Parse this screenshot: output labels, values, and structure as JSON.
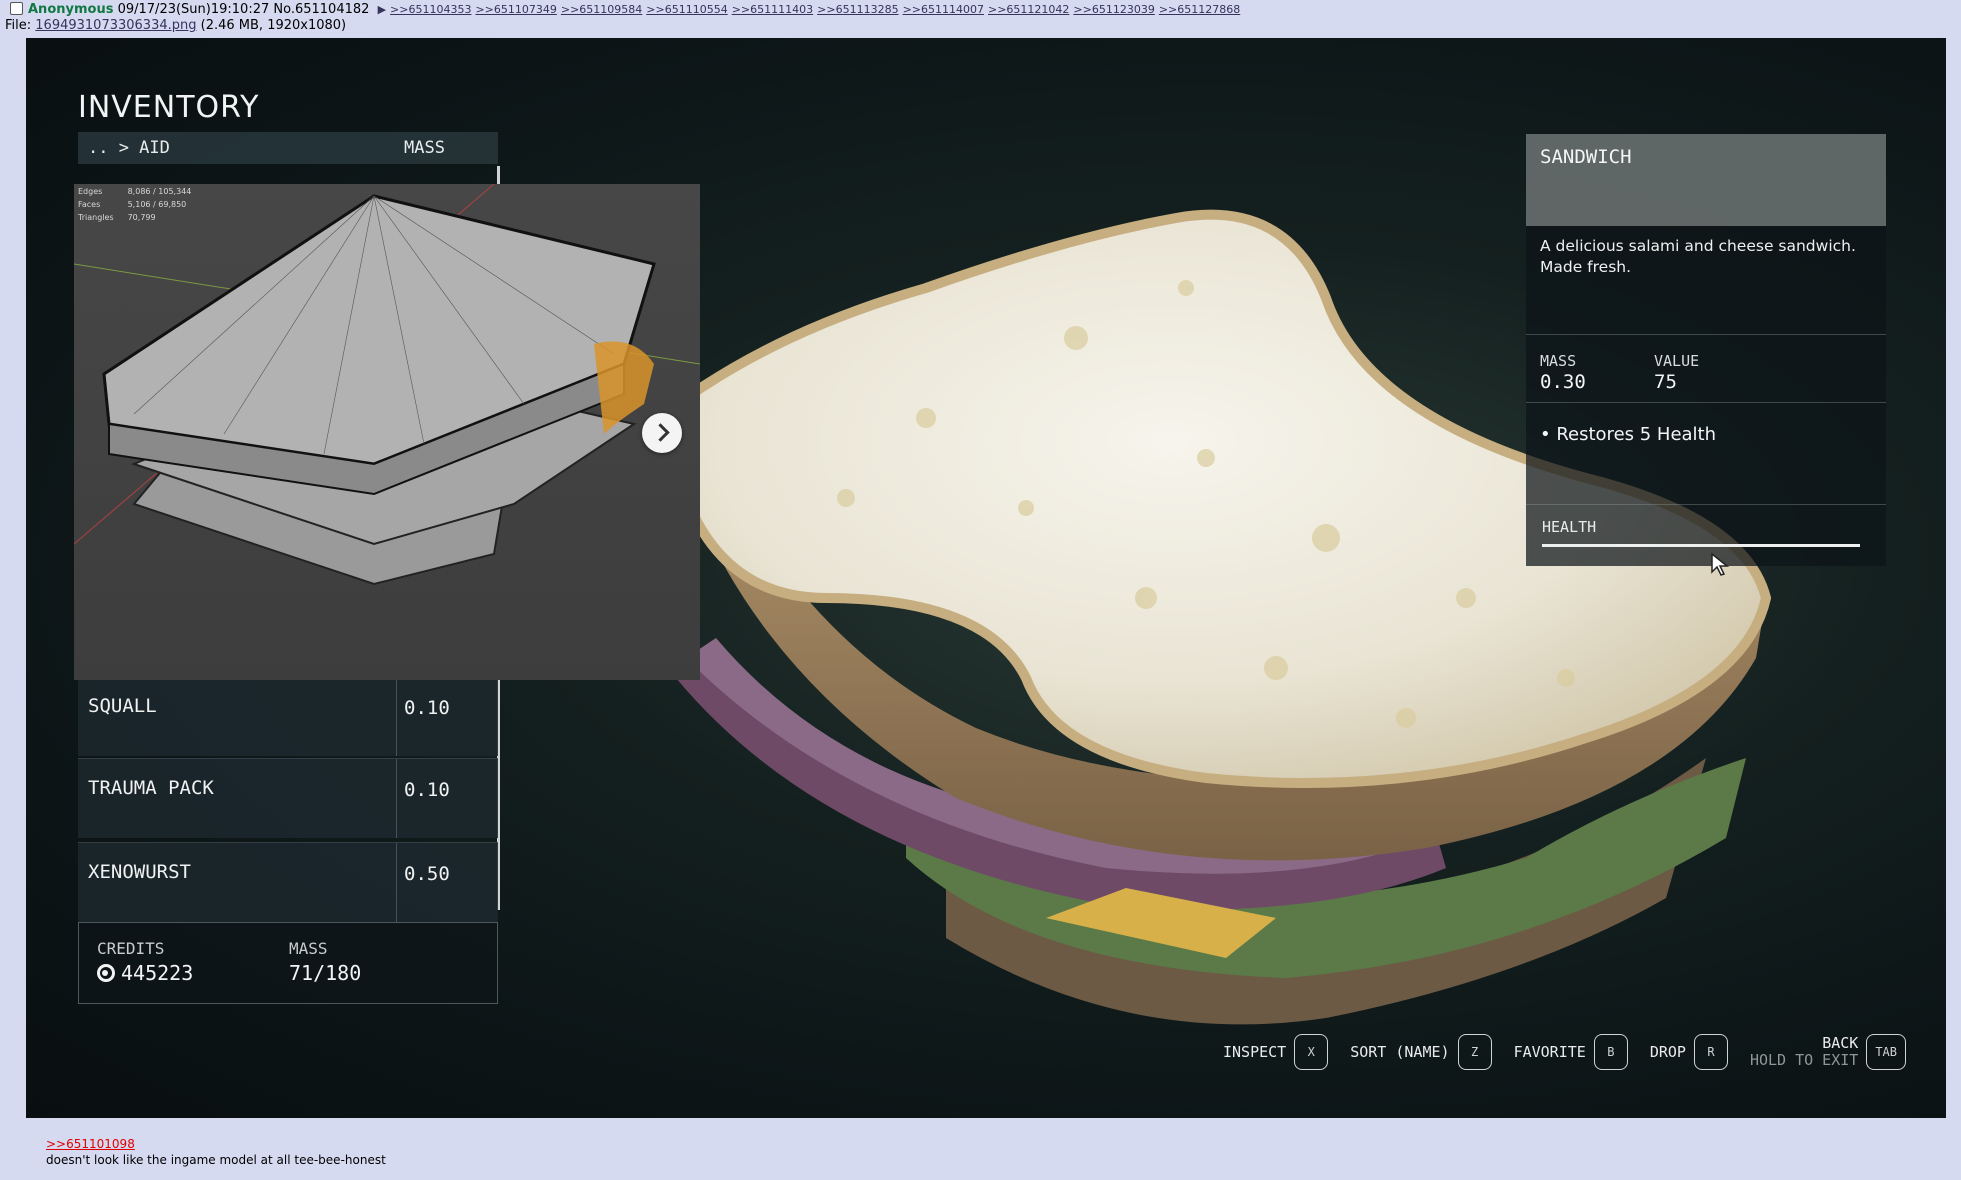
{
  "post": {
    "name": "Anonymous",
    "date": "09/17/23(Sun)19:10:27",
    "number": "No.651104182",
    "backlinks": [
      ">>651104353",
      ">>651107349",
      ">>651109584",
      ">>651110554",
      ">>651111403",
      ">>651113285",
      ">>651114007",
      ">>651121042",
      ">>651123039",
      ">>651127868"
    ],
    "file_label": "File:",
    "file_name": "1694931073306334.png",
    "file_info": "(2.46 MB, 1920x1080)",
    "quote_link": ">>651101098",
    "comment": "doesn't look like the ingame model at all tee-bee-honest"
  },
  "inventory": {
    "title": "INVENTORY",
    "breadcrumb": ".. > AID",
    "mass_header": "MASS",
    "items": [
      {
        "name": "SQUALL",
        "mass": "0.10"
      },
      {
        "name": "TRAUMA PACK",
        "mass": "0.10"
      },
      {
        "name": "XENOWURST",
        "mass": "0.50"
      }
    ],
    "credits_label": "CREDITS",
    "credits_value": "445223",
    "mass_label": "MASS",
    "mass_value": "71/180"
  },
  "blender": {
    "stats": [
      {
        "label": "Edges",
        "value": "8,086 / 105,344"
      },
      {
        "label": "Faces",
        "value": "5,106 / 69,850"
      },
      {
        "label": "Triangles",
        "value": "70,799"
      }
    ]
  },
  "detail": {
    "title": "SANDWICH",
    "description": "A delicious salami and cheese sandwich. Made fresh.",
    "mass_label": "MASS",
    "mass_value": "0.30",
    "value_label": "VALUE",
    "value_value": "75",
    "effect": "• Restores 5 Health",
    "health_label": "HEALTH",
    "health_fill": 1.0
  },
  "controls": [
    {
      "label": "INSPECT",
      "key": "X"
    },
    {
      "label": "SORT (NAME)",
      "key": "Z"
    },
    {
      "label": "FAVORITE",
      "key": "B"
    },
    {
      "label": "DROP",
      "key": "R"
    }
  ],
  "back": {
    "label": "BACK",
    "hold": "HOLD TO EXIT",
    "key": "TAB"
  },
  "colors": {
    "bg": "#d6daf0",
    "name": "#117743",
    "link": "#34345c",
    "quote": "#dd0000"
  }
}
